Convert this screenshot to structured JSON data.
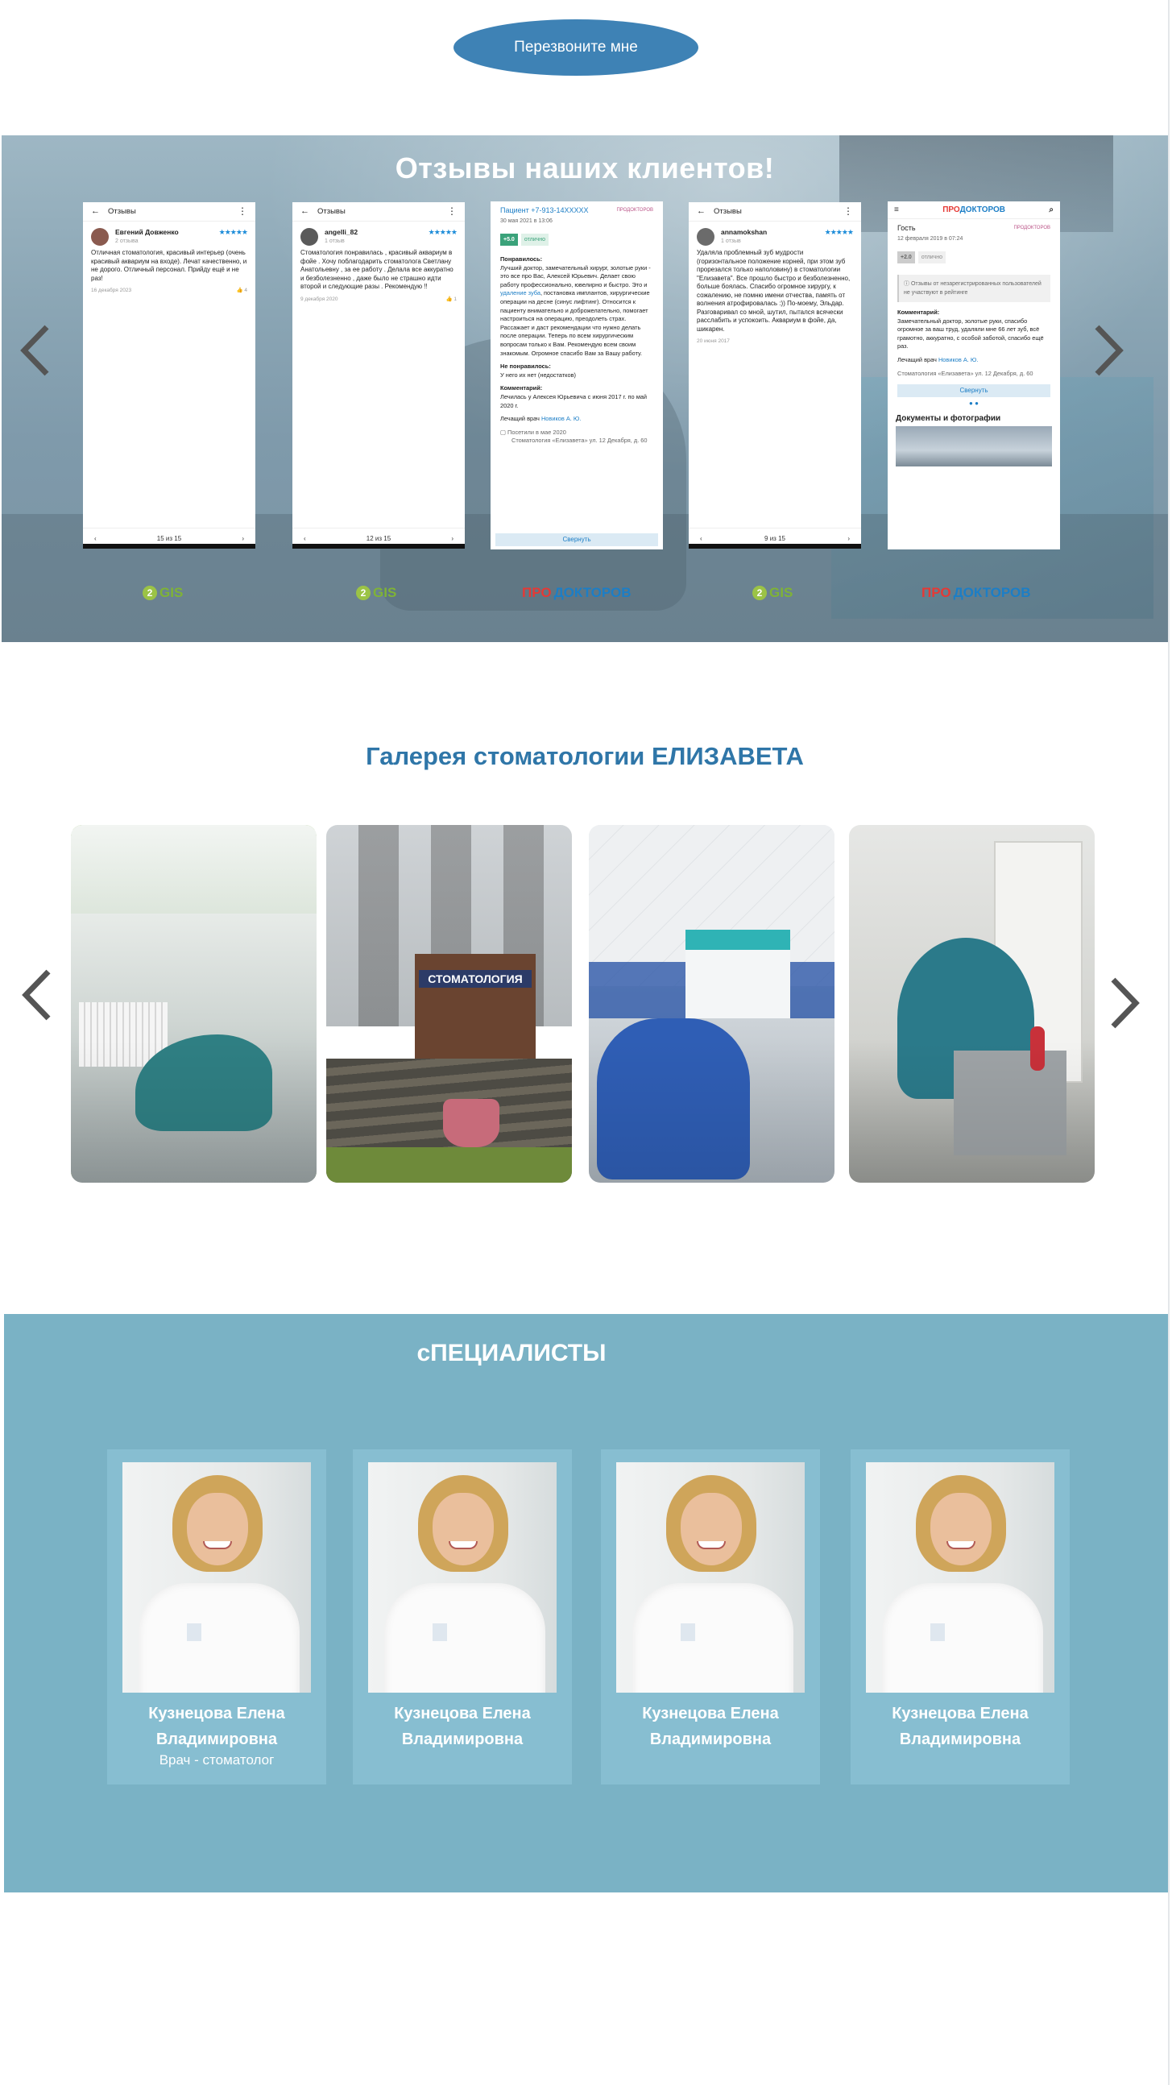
{
  "callback": {
    "label": "Перезвоните мне"
  },
  "reviews": {
    "title": "Отзывы наших клиентов!",
    "cards": [
      {
        "screen_title": "Отзывы",
        "user": "Евгений Довженко",
        "user_meta": "2 отзыва",
        "stars": "★★★★★",
        "text": "Отличная стоматология, красивый интерьер (очень красивый аквариум на входе). Лечат качественно, и не дорого. Отличный персонал. Прийду ещё и не раз!",
        "date": "16 декабря 2023",
        "likes": "4",
        "pager": "15 из 15"
      },
      {
        "screen_title": "Отзывы",
        "user": "angelli_82",
        "user_meta": "1 отзыв",
        "stars": "★★★★★",
        "text": "Стоматология понравилась , красивый аквариум в фойе . Хочу поблагодарить стоматолога Светлану Анатольевну , за ее работу . Делала все аккуратно и безболезненно , даже было не страшно идти второй и следующие разы . Рекомендую !!",
        "date": "9 декабря 2020",
        "likes": "1",
        "pager": "12 из 15"
      },
      {
        "patient": "Пациент +7-913-14XXXXX",
        "source_tag": "ПРОДОКТОРОВ",
        "date": "30 мая 2021 в 13:06",
        "score": "+5.0",
        "score_label": "отлично",
        "liked_label": "Понравилось:",
        "liked_text": "Лучший доктор, замечательный хирург, золотые руки - это все про Вас, Алексей Юрьевич. Делает свою работу профессионально, ювелирно и быстро. Это и",
        "liked_link": "удаление зуба",
        "liked_text2": ", постановка имплантов, хирургические операции на десне (синус лифтинг). Относится к пациенту внимательно и доброжелательно, помогает настроиться на операцию, преодолеть страх. Рассажает и даст рекомендации что нужно делать после операции. Теперь по всем хирургическим вопросам только к Вам. Рекомендую всем своим знакомым. Огромное спасибо Вам за Вашу работу.",
        "disliked_label": "Не понравилось:",
        "disliked_text": "У него их нет (недостатков)",
        "comment_label": "Комментарий:",
        "comment_text": "Лечилась у Алексея Юрьевича с июня 2017 г. по май 2020 г.",
        "doctor_label": "Лечащий врач",
        "doctor": "Новиков А. Ю.",
        "visit": "Посетили в мае 2020",
        "clinic": "Стоматология «Елизавета» ул. 12 Декабря, д. 60",
        "collapse": "Свернуть"
      },
      {
        "screen_title": "Отзывы",
        "user": "annamokshan",
        "user_meta": "1 отзыв",
        "stars": "★★★★★",
        "text": "Удаляла проблемный зуб мудрости (горизонтальное положение корней, при этом зуб прорезался только наполовину) в стоматологии \"Елизавета\". Все прошло быстро и безболезненно, больше боялась. Спасибо огромное хирургу, к сожалению, не помню имени отчества, память от волнения атрофировалась :)) По-моему, Эльдар. Разговаривал со мной, шутил, пытался всячески расслабить и успокоить. Аквариум в фойе, да, шикарен.",
        "date": "20 июня 2017",
        "likes": "",
        "pager": "9 из 15"
      },
      {
        "logo_a": "ПРО",
        "logo_b": "ДОКТОРОВ",
        "guest": "Гость",
        "source_tag": "ПРОДОКТОРОВ",
        "date": "12 февраля 2019 в 07:24",
        "score": "+2.0",
        "score_label": "отлично",
        "note": "Отзывы от незарегистрированных пользователей не участвуют в рейтинге",
        "comment_label": "Комментарий:",
        "comment_text": "Замечательный доктор, золотые руки, спасибо огромное за ваш труд, удаляли мне 66 лет зуб, всё грамотно, аккуратно, с особой заботой, спасибо ещё раз.",
        "doctor_label": "Лечащий врач",
        "doctor": "Новиков А. Ю.",
        "clinic": "Стоматология «Елизавета» ул. 12 Декабря, д. 60",
        "collapse": "Свернуть",
        "docs_title": "Документы и фотографии"
      }
    ],
    "brands": [
      "2GIS",
      "2GIS",
      "ПРОДОКТОРОВ",
      "2GIS",
      "ПРОДОКТОРОВ"
    ],
    "brand_2gis_num": "2",
    "brand_2gis_text": "GIS",
    "brand_pd_a": "ПРО",
    "brand_pd_b": "ДОКТОРОВ"
  },
  "gallery": {
    "title": "Галерея стоматологии ЕЛИЗАВЕТА",
    "sign_text": "СТОМАТОЛОГИЯ"
  },
  "specialists": {
    "title": "сПЕЦИАЛИСТЫ",
    "items": [
      {
        "name_line1": "Кузнецова Елена",
        "name_line2": "Владимировна",
        "role": "Врач - стоматолог"
      },
      {
        "name_line1": "Кузнецова Елена",
        "name_line2": "Владимировна",
        "role": ""
      },
      {
        "name_line1": "Кузнецова Елена",
        "name_line2": "Владимировна",
        "role": ""
      },
      {
        "name_line1": "Кузнецова Елена",
        "name_line2": "Владимировна",
        "role": ""
      }
    ]
  },
  "colors": {
    "accent": "#3e82b5",
    "specialists_bg": "#7ab2c5",
    "gallery_title": "#2f76a8"
  }
}
